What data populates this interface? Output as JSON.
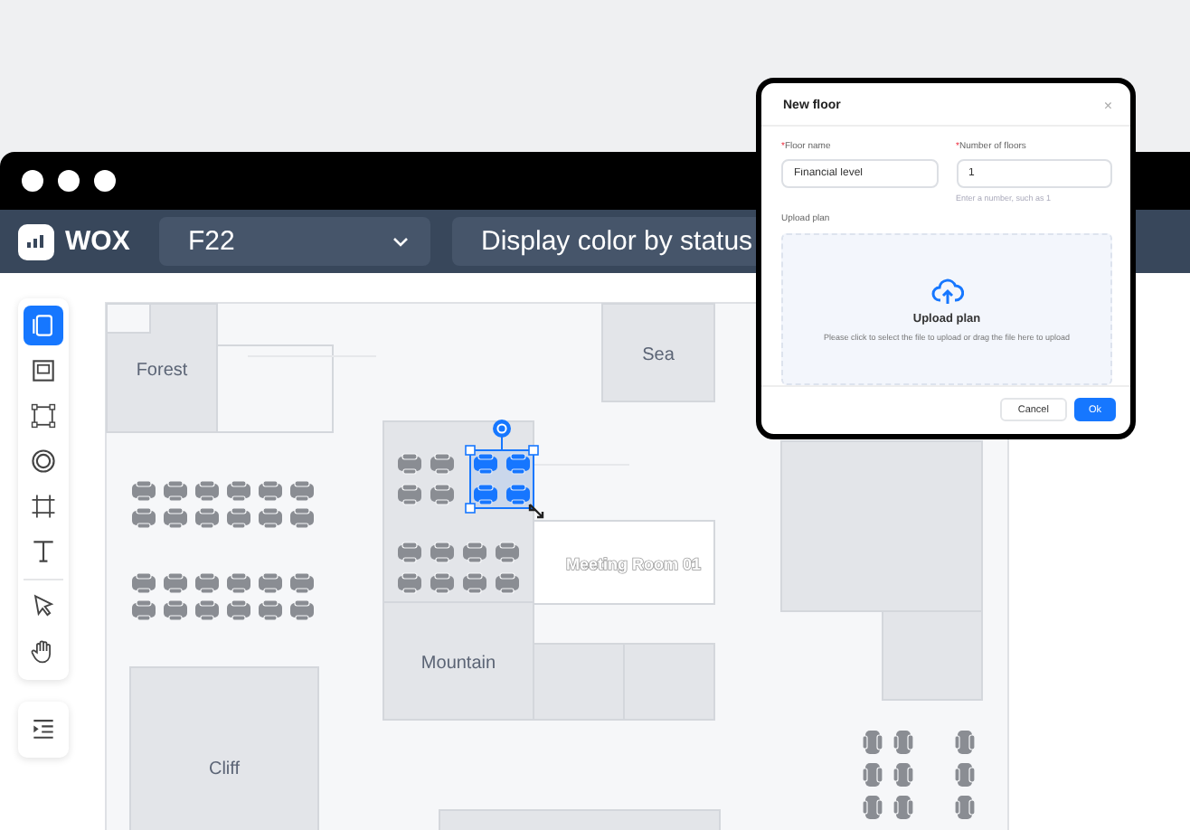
{
  "app": {
    "logo": "WOX",
    "floor_select": {
      "value": "F22"
    },
    "color_select": {
      "value": "Display color by status"
    }
  },
  "toolbar": {
    "tools": [
      {
        "kind": "pages",
        "selected": true
      },
      {
        "kind": "image",
        "selected": false
      },
      {
        "kind": "rectangle",
        "selected": false
      },
      {
        "kind": "circle",
        "selected": false
      },
      {
        "kind": "frame",
        "selected": false
      },
      {
        "kind": "text",
        "selected": false
      },
      {
        "kind": "pointer",
        "selected": false
      },
      {
        "kind": "hand",
        "selected": false
      }
    ],
    "extra": [
      {
        "kind": "outline",
        "selected": false
      }
    ]
  },
  "floor_plan": {
    "rooms": [
      {
        "label": "Forest",
        "kind": "room"
      },
      {
        "label": "Sea",
        "kind": "room"
      },
      {
        "label": "Mountain",
        "kind": "room"
      },
      {
        "label": "Cliff",
        "kind": "room"
      },
      {
        "label": "Meeting Room 01",
        "kind": "meeting"
      }
    ],
    "seat_groups": [
      {
        "selected": false
      },
      {
        "selected": false
      },
      {
        "selected": false
      },
      {
        "selected": true
      },
      {
        "selected": false
      },
      {
        "selected": false
      },
      {
        "selected": false
      }
    ]
  },
  "dialog": {
    "title": "New floor",
    "close": "×",
    "fields": [
      {
        "required_mark": "*",
        "label": "Floor name",
        "value": "Financial level"
      },
      {
        "required_mark": "*",
        "label": "Number of floors",
        "value": "1",
        "hint": "Enter a number, such as 1"
      }
    ],
    "upload": {
      "label": "Upload plan",
      "title": "Upload plan",
      "description": "Please click to select the file to upload or drag the file here to upload"
    },
    "buttons": [
      {
        "label": "Cancel",
        "primary": false
      },
      {
        "label": "Ok",
        "primary": true
      }
    ]
  }
}
